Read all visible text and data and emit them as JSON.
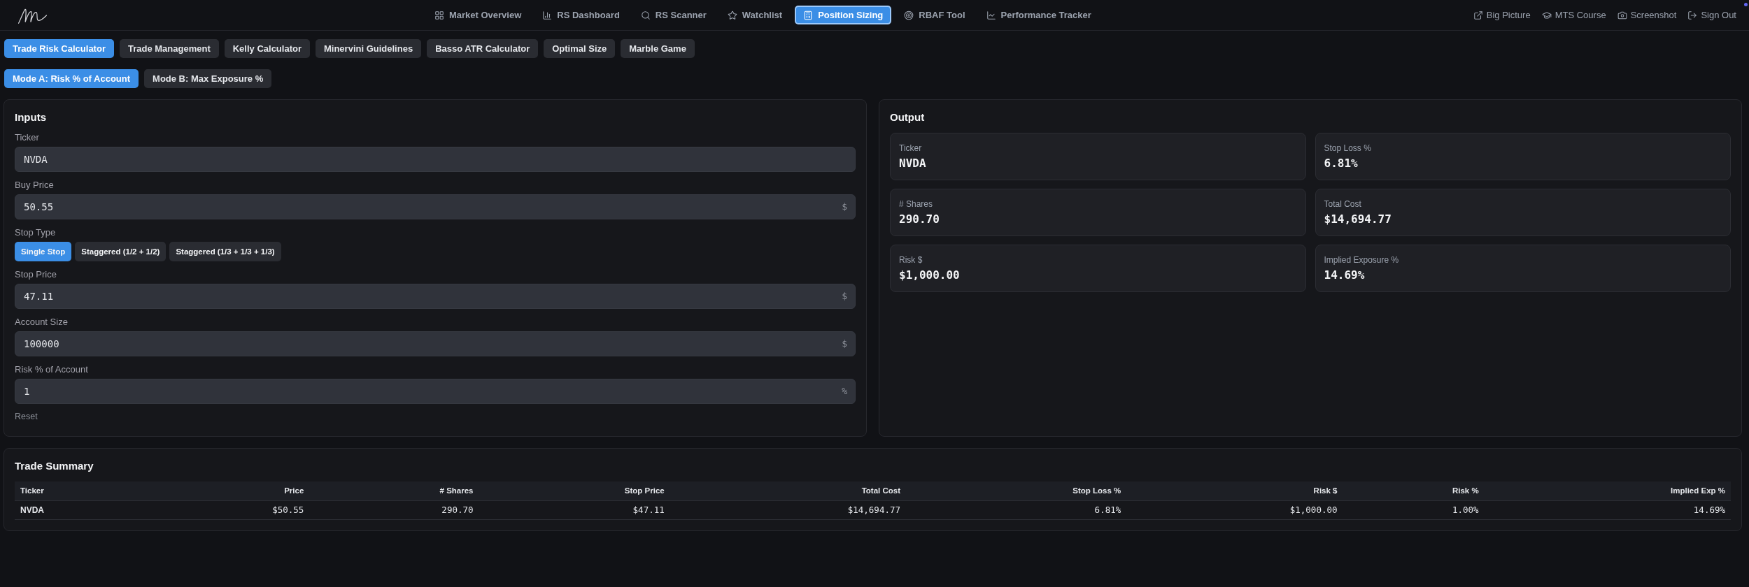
{
  "nav": {
    "items": [
      {
        "label": "Market Overview",
        "selected": false
      },
      {
        "label": "RS Dashboard",
        "selected": false
      },
      {
        "label": "RS Scanner",
        "selected": false
      },
      {
        "label": "Watchlist",
        "selected": false
      },
      {
        "label": "Position Sizing",
        "selected": true
      },
      {
        "label": "RBAF Tool",
        "selected": false
      },
      {
        "label": "Performance Tracker",
        "selected": false
      }
    ],
    "links": [
      "Big Picture",
      "MTS Course",
      "Screenshot",
      "Sign Out"
    ]
  },
  "tool_tabs": [
    {
      "label": "Trade Risk Calculator",
      "selected": true
    },
    {
      "label": "Trade Management",
      "selected": false
    },
    {
      "label": "Kelly Calculator",
      "selected": false
    },
    {
      "label": "Minervini Guidelines",
      "selected": false
    },
    {
      "label": "Basso ATR Calculator",
      "selected": false
    },
    {
      "label": "Optimal Size",
      "selected": false
    },
    {
      "label": "Marble Game",
      "selected": false
    }
  ],
  "mode_tabs": [
    {
      "label": "Mode A: Risk % of Account",
      "selected": true
    },
    {
      "label": "Mode B: Max Exposure %",
      "selected": false
    }
  ],
  "inputs": {
    "title": "Inputs",
    "fields": [
      {
        "kind": "text",
        "label": "Ticker",
        "value": "NVDA"
      },
      {
        "kind": "text",
        "label": "Buy Price",
        "value": "50.55",
        "suffix": "$"
      },
      {
        "kind": "choice",
        "label": "Stop Type",
        "options": [
          {
            "label": "Single Stop",
            "selected": true
          },
          {
            "label": "Staggered (1/2 + 1/2)",
            "selected": false
          },
          {
            "label": "Staggered (1/3 + 1/3 + 1/3)",
            "selected": false
          }
        ]
      },
      {
        "kind": "text",
        "label": "Stop Price",
        "value": "47.11",
        "suffix": "$"
      },
      {
        "kind": "text",
        "label": "Account Size",
        "value": "100000",
        "suffix": "$"
      },
      {
        "kind": "text",
        "label": "Risk % of Account",
        "value": "1",
        "suffix": "%"
      }
    ],
    "reset": "Reset"
  },
  "output": {
    "title": "Output",
    "cards": [
      {
        "label": "Ticker",
        "value": "NVDA"
      },
      {
        "label": "Stop Loss %",
        "value": "6.81%"
      },
      {
        "label": "# Shares",
        "value": "290.70"
      },
      {
        "label": "Total Cost",
        "value": "$14,694.77"
      },
      {
        "label": "Risk $",
        "value": "$1,000.00"
      },
      {
        "label": "Implied Exposure %",
        "value": "14.69%"
      }
    ]
  },
  "trade_summary": {
    "title": "Trade Summary",
    "columns": [
      "Ticker",
      "Price",
      "# Shares",
      "Stop Price",
      "Total Cost",
      "Stop Loss %",
      "Risk $",
      "Risk %",
      "Implied Exp %"
    ],
    "rows": [
      [
        "NVDA",
        "$50.55",
        "290.70",
        "$47.11",
        "$14,694.77",
        "6.81%",
        "$1,000.00",
        "1.00%",
        "14.69%"
      ]
    ]
  }
}
